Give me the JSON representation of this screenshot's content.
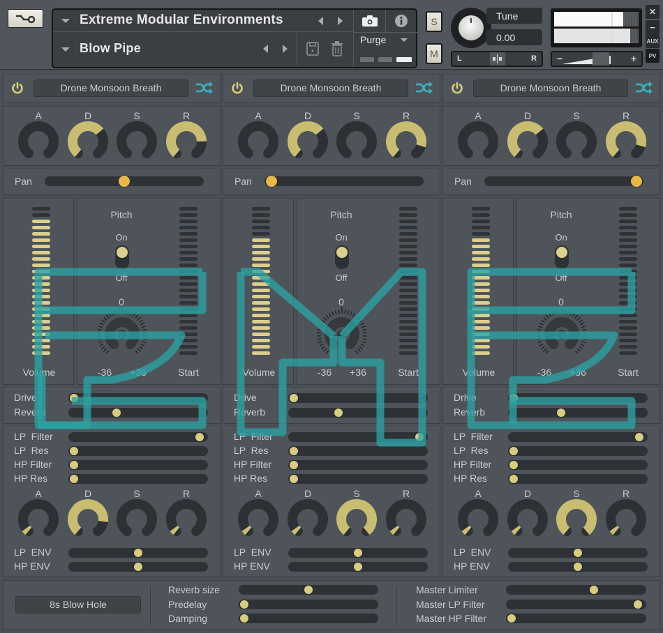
{
  "header": {
    "library_title": "Extreme Modular Environments",
    "instrument_name": "Blow Pipe",
    "purge_label": "Purge",
    "solo_label": "S",
    "mute_label": "M",
    "tune_label": "Tune",
    "tune_value": "0.00",
    "pan_left": "L",
    "pan_right": "R",
    "volume_minus": "−",
    "volume_plus": "+",
    "close_label": "✕",
    "minimize_label": "−",
    "aux_label": "AUX",
    "pv_label": "PV",
    "output_meter_levels": [
      0.82,
      0.9
    ],
    "icons": {
      "settings": "wrench-icon",
      "camera": "camera-icon",
      "info": "info-icon",
      "save": "save-icon",
      "delete": "trash-icon"
    }
  },
  "layers": [
    {
      "enabled": true,
      "preset": "Drone Monsoon Breath",
      "amp_env": {
        "labels": [
          "A",
          "D",
          "S",
          "R"
        ],
        "values": [
          0.0,
          0.68,
          0.0,
          0.82
        ]
      },
      "pan": {
        "label": "Pan",
        "value": 0.5
      },
      "volume": {
        "label": "Volume",
        "value": 0.92
      },
      "pitch": {
        "label": "Pitch",
        "switch_on_label": "On",
        "switch_off_label": "Off",
        "switch_on": true,
        "knob_zero": "0",
        "knob_min": "-36",
        "knob_max": "+36",
        "value": 0
      },
      "start": {
        "label": "Start",
        "value": 0.0
      },
      "drive": {
        "label": "Drive",
        "value": 0.0
      },
      "reverb": {
        "label": "Reverb",
        "value": 0.33
      },
      "lp_filter": {
        "label": "LP  Filter",
        "value": 0.98
      },
      "lp_res": {
        "label": "LP  Res",
        "value": 0.0
      },
      "hp_filter": {
        "label": "HP Filter",
        "value": 0.0
      },
      "hp_res": {
        "label": "HP Res",
        "value": 0.0
      },
      "filter_env": {
        "labels": [
          "A",
          "D",
          "S",
          "R"
        ],
        "values": [
          0.05,
          0.85,
          0.0,
          0.05
        ]
      },
      "lp_env": {
        "label": "LP  ENV",
        "value": 0.5
      },
      "hp_env": {
        "label": "HP ENV",
        "value": 0.5
      }
    },
    {
      "enabled": true,
      "preset": "Drone Monsoon Breath",
      "amp_env": {
        "labels": [
          "A",
          "D",
          "S",
          "R"
        ],
        "values": [
          0.0,
          0.68,
          0.0,
          0.88
        ]
      },
      "pan": {
        "label": "Pan",
        "value": 0.0
      },
      "volume": {
        "label": "Volume",
        "value": 0.79
      },
      "pitch": {
        "label": "Pitch",
        "switch_on_label": "On",
        "switch_off_label": "Off",
        "switch_on": true,
        "knob_zero": "0",
        "knob_min": "-36",
        "knob_max": "+36",
        "value": 0
      },
      "start": {
        "label": "Start",
        "value": 0.0
      },
      "drive": {
        "label": "Drive",
        "value": 0.0
      },
      "reverb": {
        "label": "Reverb",
        "value": 0.35
      },
      "lp_filter": {
        "label": "LP  Filter",
        "value": 0.98
      },
      "lp_res": {
        "label": "LP  Res",
        "value": 0.0
      },
      "hp_filter": {
        "label": "HP Filter",
        "value": 0.0
      },
      "hp_res": {
        "label": "HP Res",
        "value": 0.0
      },
      "filter_env": {
        "labels": [
          "A",
          "D",
          "S",
          "R"
        ],
        "values": [
          0.05,
          0.05,
          1.0,
          0.05
        ]
      },
      "lp_env": {
        "label": "LP  ENV",
        "value": 0.5
      },
      "hp_env": {
        "label": "HP ENV",
        "value": 0.5
      }
    },
    {
      "enabled": true,
      "preset": "Drone Monsoon Breath",
      "amp_env": {
        "labels": [
          "A",
          "D",
          "S",
          "R"
        ],
        "values": [
          0.0,
          0.68,
          0.0,
          0.88
        ]
      },
      "pan": {
        "label": "Pan",
        "value": 1.0
      },
      "volume": {
        "label": "Volume",
        "value": 0.79
      },
      "pitch": {
        "label": "Pitch",
        "switch_on_label": "On",
        "switch_off_label": "Off",
        "switch_on": true,
        "knob_zero": "0",
        "knob_min": "-36",
        "knob_max": "+36",
        "value": 0
      },
      "start": {
        "label": "Start",
        "value": 0.0
      },
      "drive": {
        "label": "Drive",
        "value": 0.0
      },
      "reverb": {
        "label": "Reverb",
        "value": 0.37
      },
      "lp_filter": {
        "label": "LP  Filter",
        "value": 0.98
      },
      "lp_res": {
        "label": "LP  Res",
        "value": 0.0
      },
      "hp_filter": {
        "label": "HP Filter",
        "value": 0.0
      },
      "hp_res": {
        "label": "HP Res",
        "value": 0.0
      },
      "filter_env": {
        "labels": [
          "A",
          "D",
          "S",
          "R"
        ],
        "values": [
          0.05,
          0.05,
          1.0,
          0.05
        ]
      },
      "lp_env": {
        "label": "LP  ENV",
        "value": 0.5
      },
      "hp_env": {
        "label": "HP ENV",
        "value": 0.5
      }
    }
  ],
  "footer": {
    "impulse_response": "8s Blow Hole",
    "reverb_size": {
      "label": "Reverb size",
      "value": 0.5
    },
    "predelay": {
      "label": "Predelay",
      "value": 0.0
    },
    "damping": {
      "label": "Damping",
      "value": 0.0
    },
    "master_limiter": {
      "label": "Master Limiter",
      "value": 0.64
    },
    "master_lp_filter": {
      "label": "Master LP Filter",
      "value": 0.98
    },
    "master_hp_filter": {
      "label": "Master HP Filter",
      "value": 0.0
    }
  },
  "colors": {
    "accent_knob": "#c9bd72",
    "knob_track": "#2d3034",
    "meter_on": "#dccf8c",
    "meter_off": "#2f3236",
    "thumb": "#d8cc80",
    "pan_thumb": "#e8b848",
    "power": "#d8d070",
    "shuffle": "#3ab0b8",
    "logo_overlay": "#2aa3a3"
  }
}
